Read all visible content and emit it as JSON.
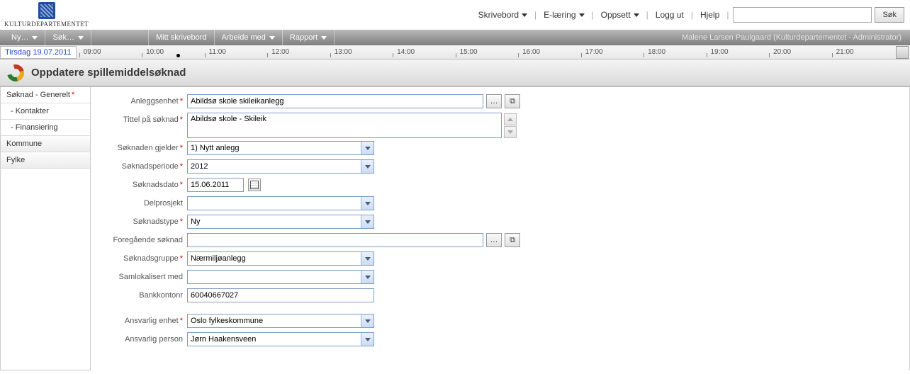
{
  "header": {
    "org_name": "KULTURDEPARTEMENTET",
    "nav": {
      "skrivebord": "Skrivebord",
      "elaering": "E-læring",
      "oppsett": "Oppsett",
      "loggut": "Logg ut",
      "hjelp": "Hjelp"
    },
    "search": {
      "placeholder": "",
      "button": "Søk"
    }
  },
  "menubar": {
    "ny": "Ny…",
    "sok": "Søk…",
    "mitt_skrivebord": "Mitt skrivebord",
    "arbeide_med": "Arbeide med",
    "rapport": "Rapport",
    "user_text": "Malene Larsen Paulgaard (Kulturdepartementet - Administrator)"
  },
  "timeline": {
    "date": "Tirsdag 19.07.2011",
    "hours": [
      "09:00",
      "10:00",
      "11:00",
      "12:00",
      "13:00",
      "14:00",
      "15:00",
      "16:00",
      "17:00",
      "18:00",
      "19:00",
      "20:00",
      "21:00"
    ]
  },
  "page_title": "Oppdatere spillemiddelsøknad",
  "sidebar": {
    "items": [
      {
        "label": "Søknad - Generelt",
        "required": true,
        "active": true
      },
      {
        "label": "- Kontakter",
        "sub": true
      },
      {
        "label": "- Finansiering",
        "sub": true
      },
      {
        "label": "Kommune"
      },
      {
        "label": "Fylke"
      }
    ]
  },
  "form": {
    "anleggsenhet": {
      "label": "Anleggsenhet",
      "required": true,
      "value": "Abildsø skole skileikanlegg"
    },
    "tittel": {
      "label": "Tittel på søknad",
      "required": true,
      "value": "Abildsø skole - Skileik"
    },
    "soknaden_gjelder": {
      "label": "Søknaden gjelder",
      "required": true,
      "value": "1) Nytt anlegg"
    },
    "soknadsperiode": {
      "label": "Søknadsperiode",
      "required": true,
      "value": "2012"
    },
    "soknadsdato": {
      "label": "Søknadsdato",
      "required": true,
      "value": "15.06.2011"
    },
    "delprosjekt": {
      "label": "Delprosjekt",
      "required": false,
      "value": ""
    },
    "soeknadstype": {
      "label": "Søknadstype",
      "required": true,
      "value": "Ny"
    },
    "foregende_soknad": {
      "label": "Foregående søknad",
      "required": false,
      "value": ""
    },
    "soknadsgruppe": {
      "label": "Søknadsgruppe",
      "required": true,
      "value": "Nærmiljøanlegg"
    },
    "samlokalisert": {
      "label": "Samlokalisert med",
      "required": false,
      "value": ""
    },
    "bankkontonr": {
      "label": "Bankkontonr",
      "required": false,
      "value": "60040667027"
    },
    "ansvarlig_enhet": {
      "label": "Ansvarlig enhet",
      "required": true,
      "value": "Oslo fylkeskommune"
    },
    "ansvarlig_person": {
      "label": "Ansvarlig person",
      "required": false,
      "value": "Jørn Haakensveen"
    }
  }
}
